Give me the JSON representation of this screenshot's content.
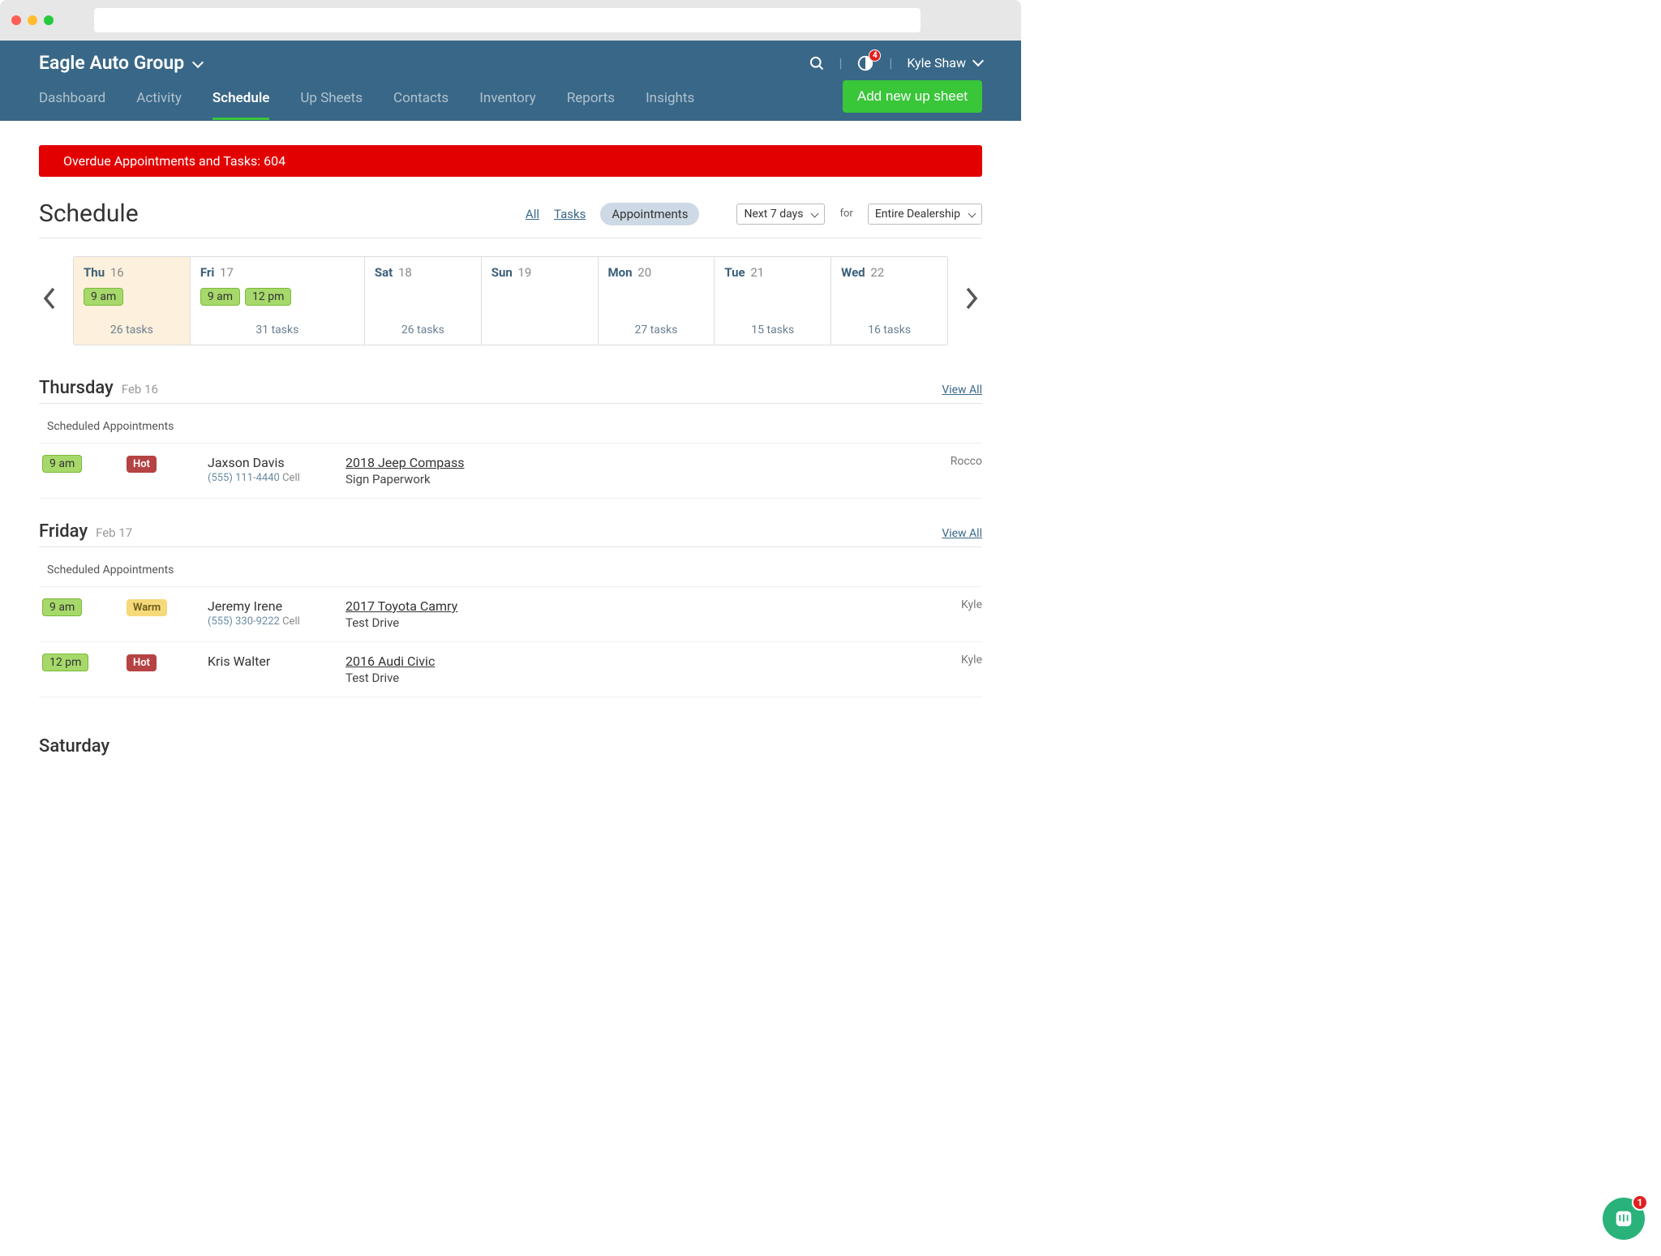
{
  "dealer_name": "Eagle Auto Group",
  "user": {
    "name": "Kyle Shaw",
    "notif_count": "4"
  },
  "nav": {
    "items": [
      "Dashboard",
      "Activity",
      "Schedule",
      "Up Sheets",
      "Contacts",
      "Inventory",
      "Reports",
      "Insights"
    ],
    "active_index": 2
  },
  "add_button": "Add new up sheet",
  "overdue": {
    "label": "Overdue Appointments and Tasks:",
    "count": "604"
  },
  "page_title": "Schedule",
  "filters": {
    "all": "All",
    "tasks": "Tasks",
    "appointments": "Appointments",
    "range": "Next 7 days",
    "for_label": "for",
    "scope": "Entire Dealership"
  },
  "week": [
    {
      "dow": "Thu",
      "num": "16",
      "times": [
        "9 am"
      ],
      "tasks": "26 tasks",
      "selected": true,
      "wide": false
    },
    {
      "dow": "Fri",
      "num": "17",
      "times": [
        "9 am",
        "12 pm"
      ],
      "tasks": "31 tasks",
      "selected": false,
      "wide": true
    },
    {
      "dow": "Sat",
      "num": "18",
      "times": [],
      "tasks": "26 tasks",
      "selected": false,
      "wide": false
    },
    {
      "dow": "Sun",
      "num": "19",
      "times": [],
      "tasks": "",
      "selected": false,
      "wide": false
    },
    {
      "dow": "Mon",
      "num": "20",
      "times": [],
      "tasks": "27 tasks",
      "selected": false,
      "wide": false
    },
    {
      "dow": "Tue",
      "num": "21",
      "times": [],
      "tasks": "15 tasks",
      "selected": false,
      "wide": false
    },
    {
      "dow": "Wed",
      "num": "22",
      "times": [],
      "tasks": "16 tasks",
      "selected": false,
      "wide": false
    }
  ],
  "sections": [
    {
      "day": "Thursday",
      "date": "Feb 16",
      "sub": "Scheduled Appointments",
      "view_all": "View All",
      "rows": [
        {
          "time": "9 am",
          "heat": "Hot",
          "heat_class": "hot",
          "person": "Jaxson Davis",
          "phone": "(555) 111-4440",
          "phone_type": "Cell",
          "vehicle": "2018 Jeep Compass",
          "type": "Sign Paperwork",
          "rep": "Rocco"
        }
      ]
    },
    {
      "day": "Friday",
      "date": "Feb 17",
      "sub": "Scheduled Appointments",
      "view_all": "View All",
      "rows": [
        {
          "time": "9 am",
          "heat": "Warm",
          "heat_class": "warm",
          "person": "Jeremy Irene",
          "phone": "(555) 330-9222",
          "phone_type": "Cell",
          "vehicle": "2017 Toyota Camry",
          "type": "Test Drive",
          "rep": "Kyle"
        },
        {
          "time": "12 pm",
          "heat": "Hot",
          "heat_class": "hot",
          "person": "Kris Walter",
          "phone": "",
          "phone_type": "",
          "vehicle": "2016 Audi Civic",
          "type": "Test Drive",
          "rep": "Kyle"
        }
      ]
    }
  ],
  "upcoming_day": "Saturday",
  "intercom_count": "1"
}
